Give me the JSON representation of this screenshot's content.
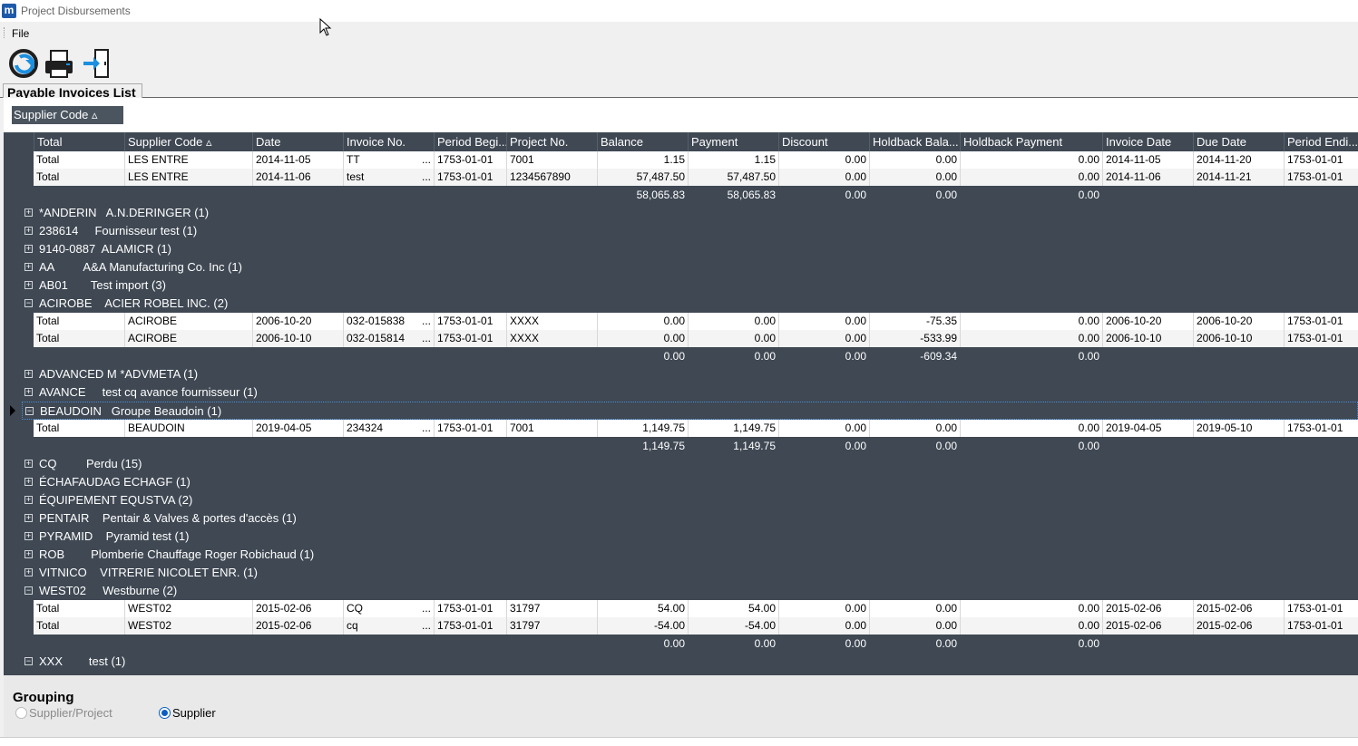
{
  "window": {
    "title": "Project Disbursements",
    "app_icon_letter": "m"
  },
  "menu": {
    "file": "File"
  },
  "toolbar": {
    "buttons": [
      {
        "name": "refresh-icon"
      },
      {
        "name": "print-icon"
      },
      {
        "name": "exit-icon"
      }
    ]
  },
  "tab": {
    "label": "Payable Invoices List"
  },
  "group_by": {
    "chip_label": "Supplier Code ▵"
  },
  "columns": [
    "Total",
    "Supplier Code ▵",
    "Date",
    "Invoice No.",
    "Period Begi...",
    "Project No.",
    "Balance",
    "Payment",
    "Discount",
    "Holdback Bala...",
    "Holdback Payment",
    "Invoice Date",
    "Due Date",
    "Period Endi..."
  ],
  "rows": [
    {
      "kind": "data",
      "cells": [
        "Total",
        "LES ENTRE",
        "2014-11-05",
        "TT",
        "1753-01-01",
        "7001",
        "1.15",
        "1.15",
        "0.00",
        "0.00",
        "0.00",
        "2014-11-05",
        "2014-11-20",
        "1753-01-01"
      ]
    },
    {
      "kind": "data",
      "cells": [
        "Total",
        "LES ENTRE",
        "2014-11-06",
        "test",
        "1753-01-01",
        "1234567890",
        "57,487.50",
        "57,487.50",
        "0.00",
        "0.00",
        "0.00",
        "2014-11-06",
        "2014-11-21",
        "1753-01-01"
      ]
    },
    {
      "kind": "sum",
      "cells": [
        "58,065.83",
        "58,065.83",
        "0.00",
        "0.00",
        "0.00"
      ]
    },
    {
      "kind": "group",
      "expanded": false,
      "label": "*ANDERIN   A.N.DERINGER (1)"
    },
    {
      "kind": "group",
      "expanded": false,
      "label": "238614     Fournisseur test (1)"
    },
    {
      "kind": "group",
      "expanded": false,
      "label": "9140-0887  ALAMICR (1)"
    },
    {
      "kind": "group",
      "expanded": false,
      "label": "AA         A&A Manufacturing Co. Inc (1)"
    },
    {
      "kind": "group",
      "expanded": false,
      "label": "AB01       Test import (3)"
    },
    {
      "kind": "group",
      "expanded": true,
      "label": "ACIROBE    ACIER ROBEL INC. (2)"
    },
    {
      "kind": "data",
      "cells": [
        "Total",
        "ACIROBE",
        "2006-10-20",
        "032-015838",
        "1753-01-01",
        "XXXX",
        "0.00",
        "0.00",
        "0.00",
        "-75.35",
        "0.00",
        "2006-10-20",
        "2006-10-20",
        "1753-01-01"
      ]
    },
    {
      "kind": "data",
      "cells": [
        "Total",
        "ACIROBE",
        "2006-10-10",
        "032-015814",
        "1753-01-01",
        "XXXX",
        "0.00",
        "0.00",
        "0.00",
        "-533.99",
        "0.00",
        "2006-10-10",
        "2006-10-10",
        "1753-01-01"
      ]
    },
    {
      "kind": "sum",
      "cells": [
        "0.00",
        "0.00",
        "0.00",
        "-609.34",
        "0.00"
      ]
    },
    {
      "kind": "group",
      "expanded": false,
      "label": "ADVANCED M *ADVMETA (1)"
    },
    {
      "kind": "group",
      "expanded": false,
      "label": "AVANCE     test cq avance fournisseur (1)"
    },
    {
      "kind": "group",
      "expanded": true,
      "selected": true,
      "label": "BEAUDOIN   Groupe Beaudoin (1)"
    },
    {
      "kind": "data",
      "cells": [
        "Total",
        "BEAUDOIN",
        "2019-04-05",
        "234324",
        "1753-01-01",
        "7001",
        "1,149.75",
        "1,149.75",
        "0.00",
        "0.00",
        "0.00",
        "2019-04-05",
        "2019-05-10",
        "1753-01-01"
      ]
    },
    {
      "kind": "sum",
      "cells": [
        "1,149.75",
        "1,149.75",
        "0.00",
        "0.00",
        "0.00"
      ]
    },
    {
      "kind": "group",
      "expanded": false,
      "label": "CQ         Perdu (15)"
    },
    {
      "kind": "group",
      "expanded": false,
      "label": "ÉCHAFAUDAG ECHAGF (1)"
    },
    {
      "kind": "group",
      "expanded": false,
      "label": "ÉQUIPEMENT EQUSTVA (2)"
    },
    {
      "kind": "group",
      "expanded": false,
      "label": "PENTAIR    Pentair & Valves & portes d'accès (1)"
    },
    {
      "kind": "group",
      "expanded": false,
      "label": "PYRAMID    Pyramid test (1)"
    },
    {
      "kind": "group",
      "expanded": false,
      "label": "ROB        Plomberie Chauffage Roger Robichaud (1)"
    },
    {
      "kind": "group",
      "expanded": false,
      "label": "VITNICO    VITRERIE NICOLET ENR. (1)"
    },
    {
      "kind": "group",
      "expanded": true,
      "label": "WEST02     Westburne (2)"
    },
    {
      "kind": "data",
      "cells": [
        "Total",
        "WEST02",
        "2015-02-06",
        "CQ",
        "1753-01-01",
        "31797",
        "54.00",
        "54.00",
        "0.00",
        "0.00",
        "0.00",
        "2015-02-06",
        "2015-02-06",
        "1753-01-01"
      ]
    },
    {
      "kind": "data",
      "cells": [
        "Total",
        "WEST02",
        "2015-02-06",
        "cq",
        "1753-01-01",
        "31797",
        "-54.00",
        "-54.00",
        "0.00",
        "0.00",
        "0.00",
        "2015-02-06",
        "2015-02-06",
        "1753-01-01"
      ]
    },
    {
      "kind": "sum",
      "cells": [
        "0.00",
        "0.00",
        "0.00",
        "0.00",
        "0.00"
      ]
    },
    {
      "kind": "group",
      "expanded": true,
      "label": "XXX        test (1)"
    }
  ],
  "grouping": {
    "title": "Grouping",
    "options": [
      {
        "label": "Supplier/Project",
        "selected": false,
        "disabled": true
      },
      {
        "label": "Supplier",
        "selected": true,
        "disabled": false
      }
    ]
  },
  "colors": {
    "grid_bg": "#3f4853",
    "chip_bg": "#4b5560",
    "radio_accent": "#0a5fc0"
  }
}
